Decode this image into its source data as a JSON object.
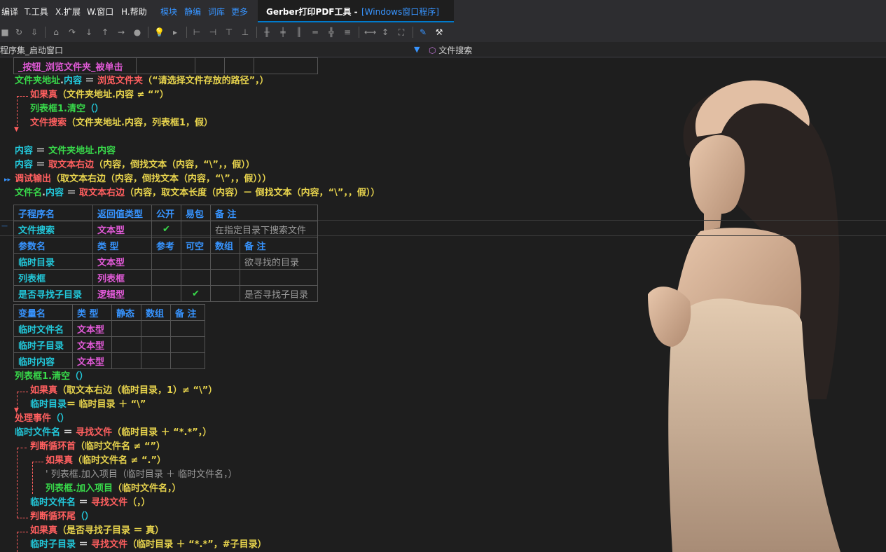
{
  "menu": {
    "items": [
      "编译",
      "T.工具",
      "X.扩展",
      "W.窗口",
      "H.帮助"
    ],
    "links": [
      "模块",
      "静编",
      "词库",
      "更多"
    ]
  },
  "title": {
    "app": "Gerber打印PDF工具 -",
    "window": "[Windows窗口程序]"
  },
  "nav": {
    "left": "程序集_启动窗口",
    "right": "文件搜索"
  },
  "code": {
    "event_header": "_按钮_浏览文件夹_被单击",
    "l1": [
      "文件夹地址",
      "内容",
      "浏览文件夹",
      "（“请选择文件存放的路径”，）"
    ],
    "l2": [
      "如果真",
      "（文件夹地址.内容 ≠ “”）"
    ],
    "l3": [
      "列表框1.清空",
      "（）"
    ],
    "l4": [
      "文件搜索",
      "（文件夹地址.内容，列表框1，假）"
    ],
    "l5": [
      "内容",
      "文件夹地址.内容"
    ],
    "l6": [
      "内容",
      "取文本右边",
      "（内容，倒找文本（内容，“\\”，，假））"
    ],
    "l7": [
      "调试输出",
      "（取文本右边（内容，倒找文本（内容，“\\”，，假）））"
    ],
    "l8": [
      "文件名",
      "内容",
      "取文本右边",
      "（内容，取文本长度（内容）－ 倒找文本（内容，“\\”，，假））"
    ],
    "sub_table": {
      "headers": [
        "子程序名",
        "返回值类型",
        "公开",
        "易包",
        "备 注"
      ],
      "row": [
        "文件搜索",
        "文本型",
        "✔",
        "",
        "在指定目录下搜索文件"
      ]
    },
    "param_table": {
      "headers": [
        "参数名",
        "类 型",
        "参考",
        "可空",
        "数组",
        "备 注"
      ],
      "rows": [
        [
          "临时目录",
          "文本型",
          "",
          "",
          "",
          "欲寻找的目录"
        ],
        [
          "列表框",
          "列表框",
          "",
          "",
          "",
          ""
        ],
        [
          "是否寻找子目录",
          "逻辑型",
          "",
          "✔",
          "",
          "是否寻找子目录"
        ]
      ]
    },
    "var_table": {
      "headers": [
        "变量名",
        "类 型",
        "静态",
        "数组",
        "备 注"
      ],
      "rows": [
        [
          "临时文件名",
          "文本型"
        ],
        [
          "临时子目录",
          "文本型"
        ],
        [
          "临时内容",
          "文本型"
        ]
      ]
    },
    "m1": [
      "列表框1.清空",
      "（）"
    ],
    "m2": [
      "如果真",
      "（取文本右边（临时目录，1）≠ “\\”）"
    ],
    "m3": [
      "临时目录",
      "＝ 临时目录 ＋ “\\”"
    ],
    "m4": [
      "处理事件",
      "（）"
    ],
    "m5": [
      "临时文件名",
      "＝",
      "寻找文件",
      "（临时目录 ＋ “*.*”，）"
    ],
    "m6": [
      "判断循环首",
      "（临时文件名 ≠ “”）"
    ],
    "m7": [
      "如果真",
      "（临时文件名 ≠ “.”）"
    ],
    "m8": "' 列表框.加入项目（临时目录 ＋ 临时文件名，）",
    "m9": [
      "列表框.加入项目",
      "（临时文件名，）"
    ],
    "m10": [
      "临时文件名",
      "＝",
      "寻找文件",
      "（，）"
    ],
    "m11": [
      "判断循环尾",
      "（）"
    ],
    "m12": [
      "如果真",
      "（是否寻找子目录 ＝ 真）"
    ],
    "m13": [
      "临时子目录",
      "＝",
      "寻找文件",
      "（临时目录 ＋ “*.*”，#子目录）"
    ]
  },
  "colors": {
    "bg": "#1e1e1e",
    "accent": "#3794ff",
    "green": "#38d94a",
    "red": "#ff5f5f",
    "cyan": "#22c7d9",
    "magenta": "#e25ad8"
  }
}
